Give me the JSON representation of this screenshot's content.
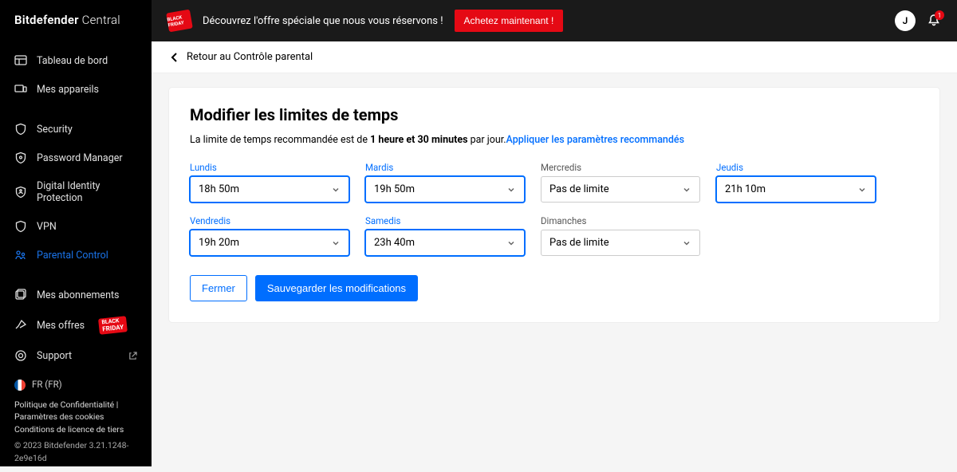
{
  "brand": {
    "name": "Bitdefender",
    "suffix": "Central"
  },
  "topbar": {
    "promo_badge": "BLACK FRIDAY",
    "promo_text": "Découvrez l'offre spéciale que nous vous réservons !",
    "cta": "Achetez maintenant !",
    "avatar_initial": "J",
    "notif_count": "1"
  },
  "sidebar": {
    "items": [
      {
        "label": "Tableau de bord"
      },
      {
        "label": "Mes appareils"
      },
      {
        "label": "Security"
      },
      {
        "label": "Password Manager"
      },
      {
        "label": "Digital Identity Protection"
      },
      {
        "label": "VPN"
      },
      {
        "label": "Parental Control"
      },
      {
        "label": "Mes abonnements"
      },
      {
        "label": "Mes offres",
        "badge_top": "BLACK",
        "badge_bot": "FRIDAY"
      },
      {
        "label": "Support"
      }
    ],
    "lang": "FR (FR)",
    "footer_links": [
      "Politique de Confidentialité",
      "Paramètres des cookies",
      "Conditions de licence de tiers"
    ],
    "copyright": "© 2023 Bitdefender 3.21.1248-2e9e16d"
  },
  "breadcrumb": {
    "back": "Retour au Contrôle parental"
  },
  "page": {
    "title": "Modifier les limites de temps",
    "rec_prefix": "La limite de temps recommandée est de ",
    "rec_bold": "1 heure et 30 minutes",
    "rec_suffix": " par jour.",
    "rec_link": "Appliquer les paramètres recommandés",
    "days": [
      {
        "label": "Lundis",
        "value": "18h 50m",
        "active": true
      },
      {
        "label": "Mardis",
        "value": "19h 50m",
        "active": true
      },
      {
        "label": "Mercredis",
        "value": "Pas de limite",
        "active": false
      },
      {
        "label": "Jeudis",
        "value": "21h 10m",
        "active": true
      },
      {
        "label": "Vendredis",
        "value": "19h 20m",
        "active": true
      },
      {
        "label": "Samedis",
        "value": "23h 40m",
        "active": true
      },
      {
        "label": "Dimanches",
        "value": "Pas de limite",
        "active": false
      }
    ],
    "close": "Fermer",
    "save": "Sauvegarder les modifications"
  }
}
